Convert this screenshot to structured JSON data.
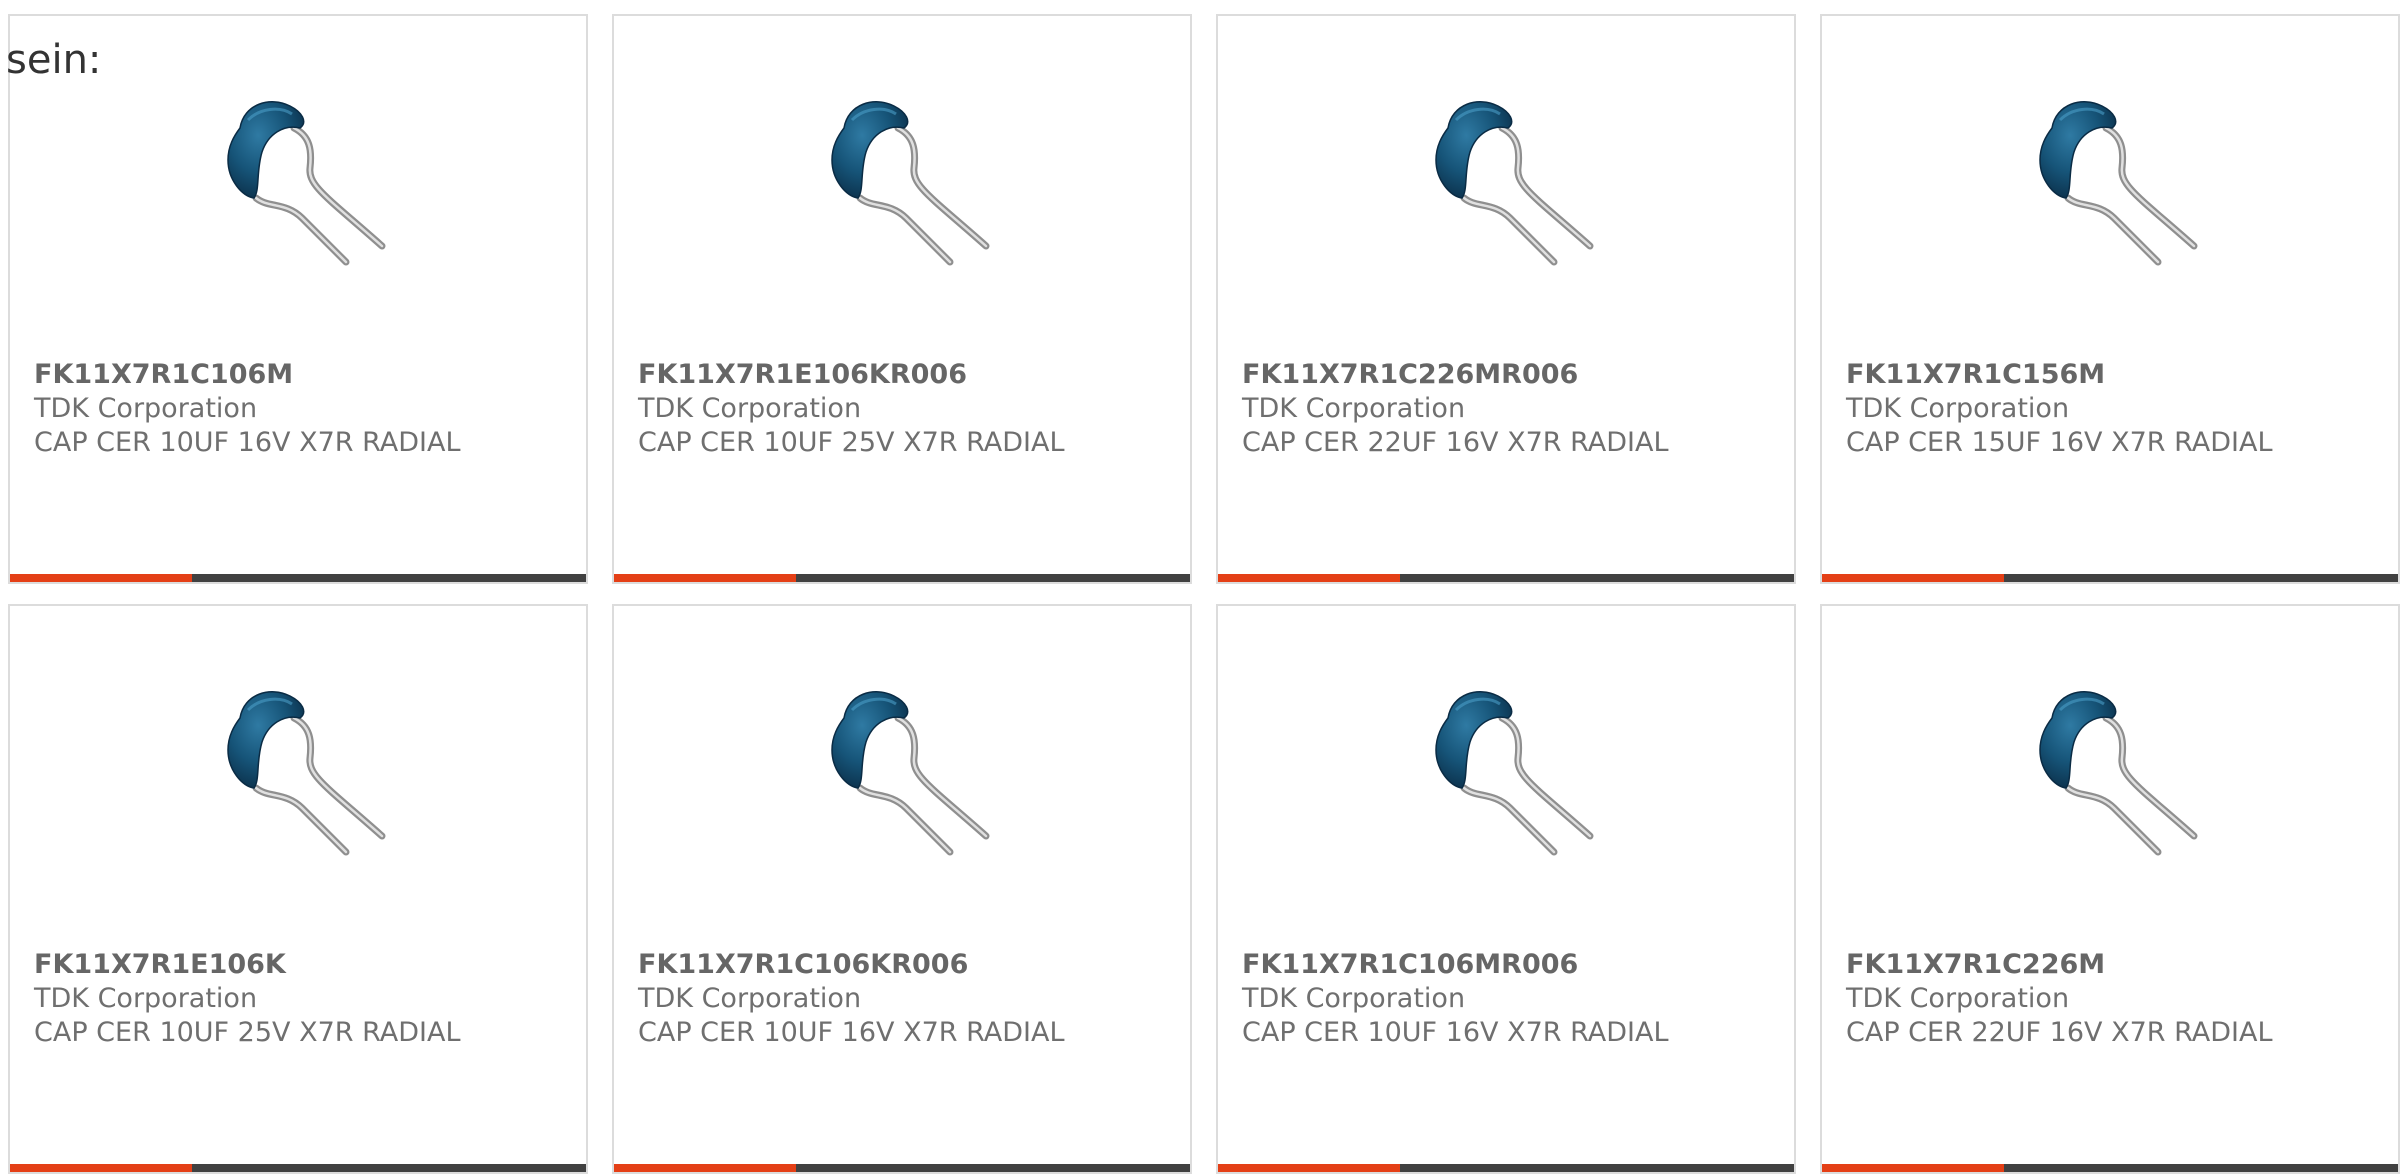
{
  "intro_text": "sein:",
  "colors": {
    "accent": "#e43f16",
    "bar_rest": "#414141",
    "card_border": "#dcdcdc",
    "text": "#6f6f6f"
  },
  "icons": {
    "product_image": "radial-ceramic-capacitor-image"
  },
  "products": [
    {
      "part": "FK11X7R1C106M",
      "manufacturer": "TDK Corporation",
      "description": "CAP CER 10UF 16V X7R RADIAL"
    },
    {
      "part": "FK11X7R1E106KR006",
      "manufacturer": "TDK Corporation",
      "description": "CAP CER 10UF 25V X7R RADIAL"
    },
    {
      "part": "FK11X7R1C226MR006",
      "manufacturer": "TDK Corporation",
      "description": "CAP CER 22UF 16V X7R RADIAL"
    },
    {
      "part": "FK11X7R1C156M",
      "manufacturer": "TDK Corporation",
      "description": "CAP CER 15UF 16V X7R RADIAL"
    },
    {
      "part": "FK11X7R1E106K",
      "manufacturer": "TDK Corporation",
      "description": "CAP CER 10UF 25V X7R RADIAL"
    },
    {
      "part": "FK11X7R1C106KR006",
      "manufacturer": "TDK Corporation",
      "description": "CAP CER 10UF 16V X7R RADIAL"
    },
    {
      "part": "FK11X7R1C106MR006",
      "manufacturer": "TDK Corporation",
      "description": "CAP CER 10UF 16V X7R RADIAL"
    },
    {
      "part": "FK11X7R1C226M",
      "manufacturer": "TDK Corporation",
      "description": "CAP CER 22UF 16V X7R RADIAL"
    }
  ]
}
